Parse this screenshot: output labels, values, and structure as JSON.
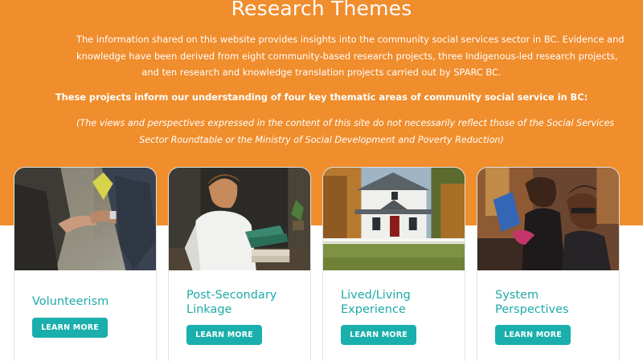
{
  "hero": {
    "title": "Research Themes",
    "intro_lines": [
      "The information shared on this website provides insights into the community social services sector in BC.  Evidence and",
      "knowledge have been derived from eight community-based research projects, three Indigenous-led research projects,",
      "and ten research and knowledge translation projects carried out by SPARC BC."
    ],
    "projects_line": "These projects inform our understanding of four key thematic areas of community social service in BC:",
    "disclaimer_lines": [
      "(The views and perspectives expressed in the content of this site do not necessarily reflect those of the Social Services",
      "Sector Roundtable or the Ministry of Social Development and Poverty Reduction)"
    ]
  },
  "cards": [
    {
      "title_lines": [
        "Volunteerism"
      ],
      "button": "LEARN MORE",
      "photo": "hands-reaching-photo"
    },
    {
      "title_lines": [
        "Post-Secondary",
        "Linkage"
      ],
      "button": "LEARN MORE",
      "photo": "student-reading-photo"
    },
    {
      "title_lines": [
        "Lived/Living",
        "Experience"
      ],
      "button": "LEARN MORE",
      "photo": "white-house-photo"
    },
    {
      "title_lines": [
        "System",
        "Perspectives"
      ],
      "button": "LEARN MORE",
      "photo": "people-at-computer-photo"
    }
  ],
  "colors": {
    "hero_background": "#f08d2c",
    "accent_teal": "#1aafac",
    "card_title": "#1faaa8"
  }
}
